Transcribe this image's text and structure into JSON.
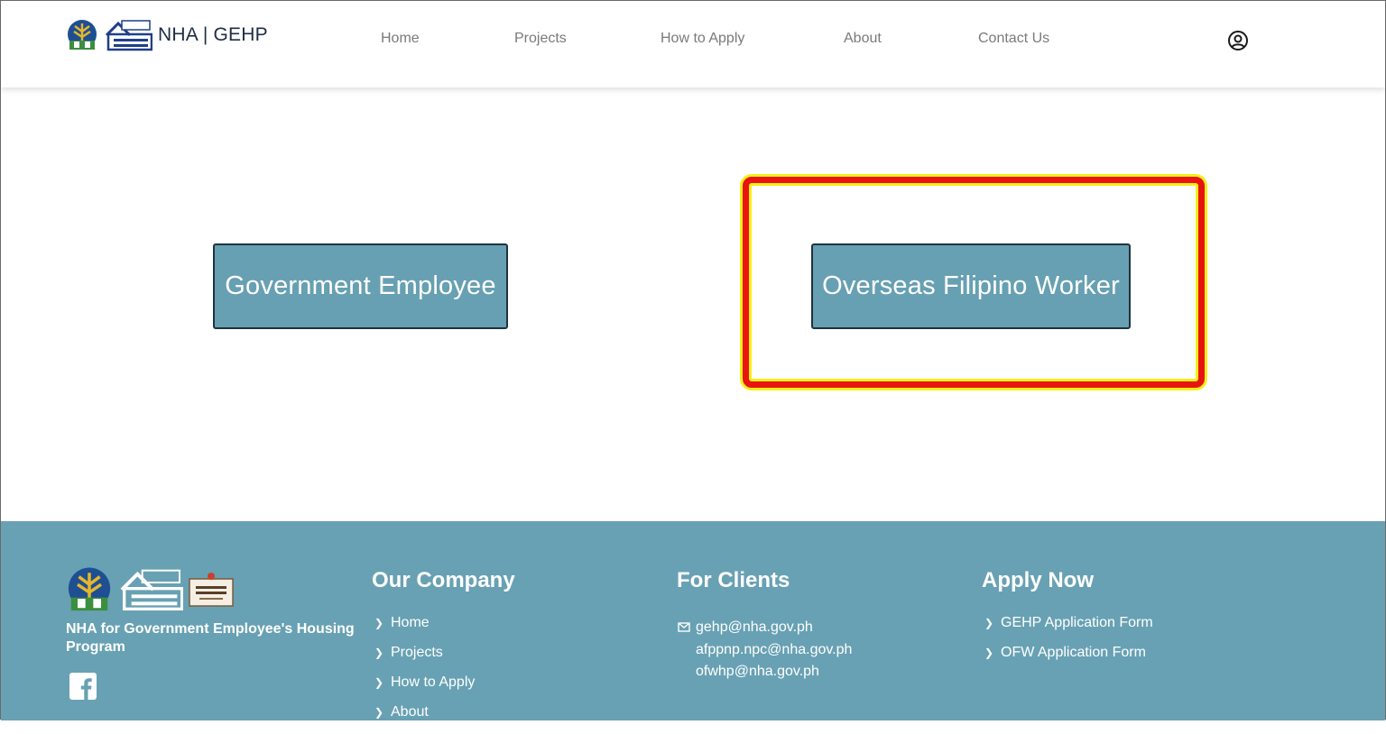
{
  "header": {
    "brand_text": "NHA | GEHP",
    "nav": [
      {
        "label": "Home"
      },
      {
        "label": "Projects"
      },
      {
        "label": "How to Apply"
      },
      {
        "label": "About"
      },
      {
        "label": "Contact Us"
      }
    ]
  },
  "main": {
    "gov_button_label": "Government Employee",
    "ofw_button_label": "Overseas Filipino Worker"
  },
  "footer": {
    "description": "NHA for Government Employee's Housing Program",
    "our_company": {
      "title": "Our Company",
      "links": [
        "Home",
        "Projects",
        "How to Apply",
        "About"
      ]
    },
    "for_clients": {
      "title": "For Clients",
      "emails": [
        "gehp@nha.gov.ph",
        "afppnp.npc@nha.gov.ph",
        "ofwhp@nha.gov.ph"
      ]
    },
    "apply_now": {
      "title": "Apply Now",
      "links": [
        "GEHP Application Form",
        "OFW Application Form"
      ]
    }
  },
  "colors": {
    "button_bg": "#67a0b2",
    "footer_bg": "#68a1b3",
    "highlight_border": "#e8140f",
    "highlight_glow": "#f5ef1a"
  },
  "icons": [
    "tree-logo-icon",
    "build-better-more-logo-icon",
    "user-circle-icon",
    "facebook-icon",
    "envelope-icon",
    "chevron-right-icon"
  ]
}
